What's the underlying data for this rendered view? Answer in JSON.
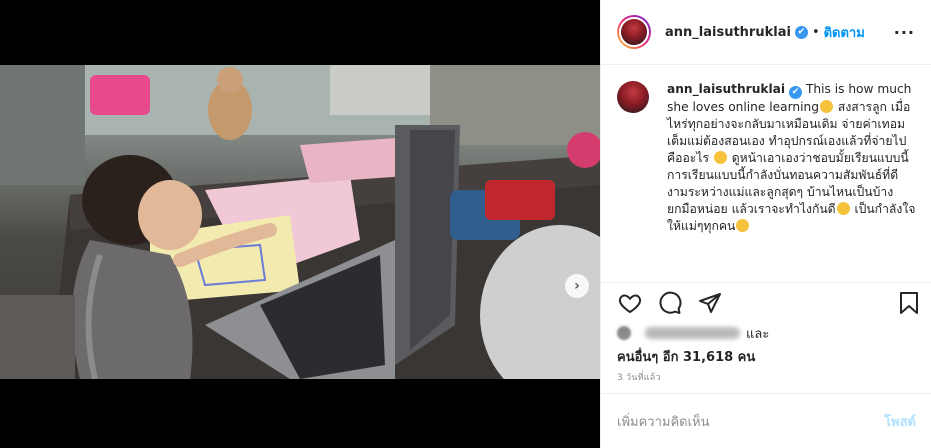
{
  "header": {
    "username": "ann_laisuthruklai",
    "verified_icon": "✔",
    "separator": "•",
    "follow_label": "ติดตาม",
    "more_icon": "···"
  },
  "caption": {
    "username": "ann_laisuthruklai",
    "verified_icon": "✔",
    "text_parts": [
      "This is how much she loves online learning",
      " สงสารลูก เมื่อไหร่ทุกอย่างจะกลับมาเหมือนเดิม จ่ายค่าเทอมเต็มแม่ต้องสอนเอง ทำอุปกรณ์เองแล้วที่จ่ายไปคืออะไร",
      " ดูหน้าเอาเองว่าชอบมั้ยเรียนแบบนี้ การเรียนแบบนี้กำลังบั่นทอนความสัมพันธ์ที่ดีงามระหว่างแม่และลูกสุดๆ บ้านไหนเป็นบ้างยกมือหน่อย แล้วเราจะทำไงกันดี",
      " เป็นกำลังใจให้แม่ๆทุกคน"
    ]
  },
  "likes": {
    "and_label": "และ",
    "others_label": "คนอื่นๆ อีก 31,618 คน"
  },
  "timestamp": "3 วันที่แล้ว",
  "comment": {
    "placeholder": "เพิ่มความคิดเห็น",
    "post_label": "โพสต์"
  },
  "media": {
    "next_icon": "›",
    "slide_count": 2,
    "active_slide": 1
  },
  "colors": {
    "follow": "#0095f6",
    "post_disabled": "#b2dffc",
    "verified": "#3897f0"
  }
}
